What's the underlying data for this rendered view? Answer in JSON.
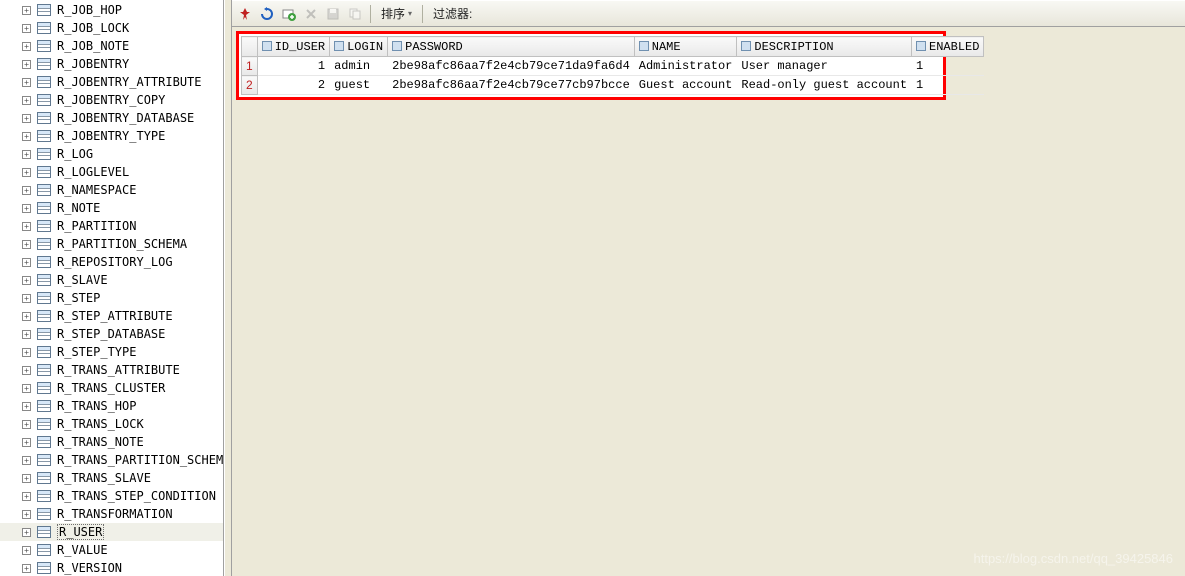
{
  "sidebar": {
    "items": [
      {
        "label": "R_JOB_HOP",
        "selected": false
      },
      {
        "label": "R_JOB_LOCK",
        "selected": false
      },
      {
        "label": "R_JOB_NOTE",
        "selected": false
      },
      {
        "label": "R_JOBENTRY",
        "selected": false
      },
      {
        "label": "R_JOBENTRY_ATTRIBUTE",
        "selected": false
      },
      {
        "label": "R_JOBENTRY_COPY",
        "selected": false
      },
      {
        "label": "R_JOBENTRY_DATABASE",
        "selected": false
      },
      {
        "label": "R_JOBENTRY_TYPE",
        "selected": false
      },
      {
        "label": "R_LOG",
        "selected": false
      },
      {
        "label": "R_LOGLEVEL",
        "selected": false
      },
      {
        "label": "R_NAMESPACE",
        "selected": false
      },
      {
        "label": "R_NOTE",
        "selected": false
      },
      {
        "label": "R_PARTITION",
        "selected": false
      },
      {
        "label": "R_PARTITION_SCHEMA",
        "selected": false
      },
      {
        "label": "R_REPOSITORY_LOG",
        "selected": false
      },
      {
        "label": "R_SLAVE",
        "selected": false
      },
      {
        "label": "R_STEP",
        "selected": false
      },
      {
        "label": "R_STEP_ATTRIBUTE",
        "selected": false
      },
      {
        "label": "R_STEP_DATABASE",
        "selected": false
      },
      {
        "label": "R_STEP_TYPE",
        "selected": false
      },
      {
        "label": "R_TRANS_ATTRIBUTE",
        "selected": false
      },
      {
        "label": "R_TRANS_CLUSTER",
        "selected": false
      },
      {
        "label": "R_TRANS_HOP",
        "selected": false
      },
      {
        "label": "R_TRANS_LOCK",
        "selected": false
      },
      {
        "label": "R_TRANS_NOTE",
        "selected": false
      },
      {
        "label": "R_TRANS_PARTITION_SCHEMA",
        "selected": false
      },
      {
        "label": "R_TRANS_SLAVE",
        "selected": false
      },
      {
        "label": "R_TRANS_STEP_CONDITION",
        "selected": false
      },
      {
        "label": "R_TRANSFORMATION",
        "selected": false
      },
      {
        "label": "R_USER",
        "selected": true
      },
      {
        "label": "R_VALUE",
        "selected": false
      },
      {
        "label": "R_VERSION",
        "selected": false
      }
    ]
  },
  "toolbar": {
    "sort_label": "排序",
    "filter_label": "过滤器:"
  },
  "grid": {
    "columns": [
      "ID_USER",
      "LOGIN",
      "PASSWORD",
      "NAME",
      "DESCRIPTION",
      "ENABLED"
    ],
    "rows": [
      {
        "n": "1",
        "ID_USER": "1",
        "LOGIN": "admin",
        "PASSWORD": "2be98afc86aa7f2e4cb79ce71da9fa6d4",
        "NAME": "Administrator",
        "DESCRIPTION": "User manager",
        "ENABLED": "1"
      },
      {
        "n": "2",
        "ID_USER": "2",
        "LOGIN": "guest",
        "PASSWORD": "2be98afc86aa7f2e4cb79ce77cb97bcce",
        "NAME": "Guest account",
        "DESCRIPTION": "Read-only guest account",
        "ENABLED": "1"
      }
    ]
  },
  "watermark": "https://blog.csdn.net/qq_39425846"
}
